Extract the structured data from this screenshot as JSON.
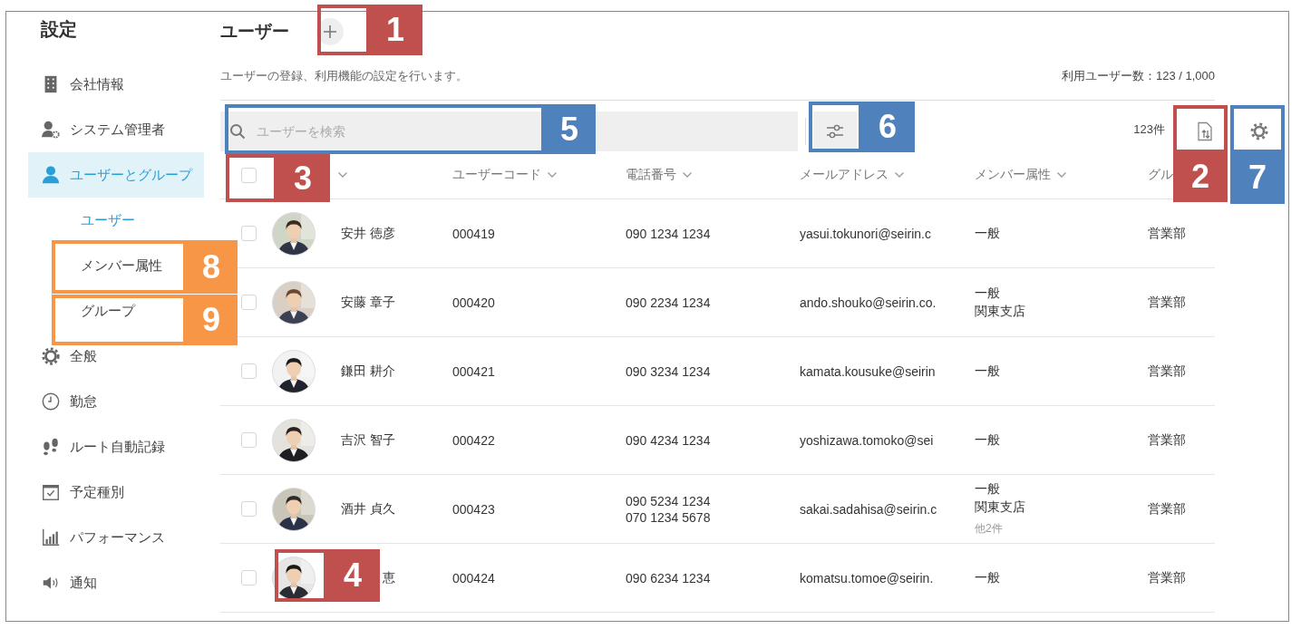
{
  "sidebar": {
    "title": "設定",
    "items": [
      {
        "label": "会社情報",
        "selected": false
      },
      {
        "label": "システム管理者",
        "selected": false
      },
      {
        "label": "ユーザーとグループ",
        "selected": true,
        "children": [
          {
            "label": "ユーザー",
            "selected": true
          },
          {
            "label": "メンバー属性",
            "selected": false
          },
          {
            "label": "グループ",
            "selected": false
          }
        ]
      },
      {
        "label": "全般",
        "selected": false
      },
      {
        "label": "勤怠",
        "selected": false
      },
      {
        "label": "ルート自動記録",
        "selected": false
      },
      {
        "label": "予定種別",
        "selected": false
      },
      {
        "label": "パフォーマンス",
        "selected": false
      },
      {
        "label": "通知",
        "selected": false
      }
    ]
  },
  "header": {
    "title": "ユーザー",
    "description": "ユーザーの登録、利用機能の設定を行います。",
    "usage": "利用ユーザー数：123 / 1,000"
  },
  "toolbar": {
    "search": {
      "placeholder": "ユーザーを検索"
    },
    "count": "123件"
  },
  "table": {
    "select_all": {
      "checked": false
    },
    "columns": [
      {
        "sortable": true
      },
      {
        "label": "ユーザーコード",
        "sortable": true
      },
      {
        "label": "電話番号",
        "sortable": true
      },
      {
        "label": "メールアドレス",
        "sortable": true
      },
      {
        "label": "メンバー属性",
        "sortable": true
      },
      {
        "label": "グル",
        "sortable": false
      }
    ],
    "rows": [
      {
        "checked": false,
        "name": "安井 徳彦",
        "code": "000419",
        "phones": [
          "090 1234 1234"
        ],
        "email": "yasui.tokunori@seirin.c",
        "attributes": [
          "一般"
        ],
        "group": "営業部"
      },
      {
        "checked": false,
        "name": "安藤 章子",
        "code": "000420",
        "phones": [
          "090 2234 1234"
        ],
        "email": "ando.shouko@seirin.co.",
        "attributes": [
          "一般",
          "関東支店"
        ],
        "group": "営業部"
      },
      {
        "checked": false,
        "name": "鎌田 耕介",
        "code": "000421",
        "phones": [
          "090 3234 1234"
        ],
        "email": "kamata.kousuke@seirin",
        "attributes": [
          "一般"
        ],
        "group": "営業部"
      },
      {
        "checked": false,
        "name": "吉沢 智子",
        "code": "000422",
        "phones": [
          "090 4234 1234"
        ],
        "email": "yoshizawa.tomoko@sei",
        "attributes": [
          "一般"
        ],
        "group": "営業部"
      },
      {
        "checked": false,
        "name": "酒井 貞久",
        "code": "000423",
        "phones": [
          "090 5234 1234",
          "070 1234 5678"
        ],
        "email": "sakai.sadahisa@seirin.c",
        "attributes": [
          "一般",
          "関東支店"
        ],
        "attributes_more": "他2件",
        "group": "営業部"
      },
      {
        "checked": false,
        "name": "恵",
        "code": "000424",
        "phones": [
          "090 6234 1234"
        ],
        "email": "komatsu.tomoe@seirin.",
        "attributes": [
          "一般"
        ],
        "group": "営業部"
      }
    ]
  },
  "callouts": [
    {
      "number": "1",
      "color": "#c0504d"
    },
    {
      "number": "5",
      "color": "#4f81bd"
    },
    {
      "number": "3",
      "color": "#c0504d"
    },
    {
      "number": "6",
      "color": "#4f81bd"
    },
    {
      "number": "2",
      "color": "#c0504d"
    },
    {
      "number": "7",
      "color": "#4f81bd"
    },
    {
      "number": "8",
      "color": "#f79646"
    },
    {
      "number": "9",
      "color": "#f79646"
    },
    {
      "number": "4",
      "color": "#c0504d"
    }
  ]
}
